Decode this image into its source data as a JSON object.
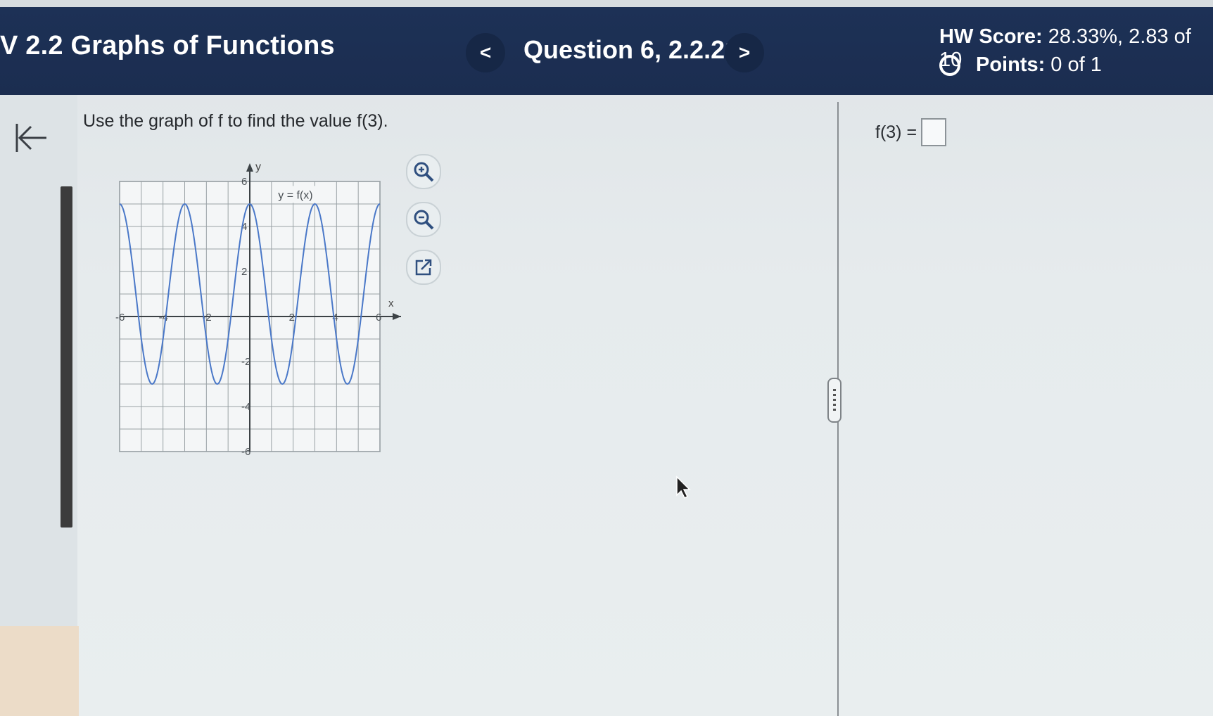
{
  "header": {
    "title": "V 2.2 Graphs of Functions",
    "prev_label": "<",
    "question_title": "Question 6, 2.2.21",
    "next_label": ">",
    "hw_score_label": "HW Score:",
    "hw_score_value": "28.33%, 2.83 of 10",
    "points_label": "Points:",
    "points_value": "0 of 1"
  },
  "question": {
    "prompt": "Use the graph of f to find the value f(3).",
    "graph": {
      "y_axis_label": "y",
      "x_axis_label": "x",
      "function_label": "y = f(x)",
      "x_tick_labels": [
        "-6",
        "-4",
        "-2",
        "2",
        "4",
        "6"
      ],
      "y_tick_labels": [
        "6",
        "4",
        "2",
        "-2",
        "-4",
        "-6"
      ],
      "curve_peaks_x": [
        -6,
        -3,
        0,
        3,
        6
      ],
      "curve_troughs_x": [
        -4.5,
        -1.5,
        1.5,
        4.5
      ],
      "peak_y": 5,
      "trough_y": -3,
      "x_range": [
        -6,
        6
      ],
      "y_range": [
        -6,
        6
      ],
      "curve_color": "#4a78c8"
    }
  },
  "tools": {
    "zoom_in_icon": "zoom-in-icon",
    "zoom_out_icon": "zoom-out-icon",
    "popout_icon": "external-link-icon"
  },
  "answer": {
    "label": "f(3) =",
    "value": ""
  }
}
